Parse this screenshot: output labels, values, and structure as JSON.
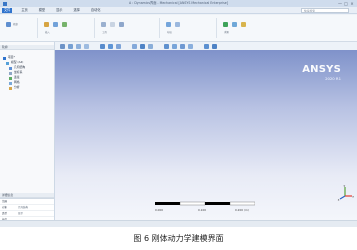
{
  "window": {
    "title": "A : Dynamics界面 - Mechanical [ANSYS Mechanical Enterprise]",
    "controls": [
      "—",
      "□",
      "×"
    ]
  },
  "menu": {
    "items": [
      "文件",
      "主页",
      "模型",
      "显示",
      "选择",
      "自动化"
    ]
  },
  "search": {
    "placeholder": "快速搜索"
  },
  "ribbon": {
    "groups": [
      "轮廓",
      "插入",
      "工具",
      "布局",
      "求解"
    ]
  },
  "left_panel": {
    "outline_title": "轮廓",
    "tree_root": "项目*",
    "tree_items": [
      "模型 (A4)",
      "几何结构",
      "坐标系",
      "连接",
      "网格",
      "分析"
    ],
    "details_title": "详细信息",
    "details_rows": [
      {
        "label": "范围",
        "value": ""
      },
      {
        "label": "对象",
        "value": "几何结构"
      },
      {
        "label": "类型",
        "value": "显示"
      },
      {
        "label": "长度",
        "value": ""
      },
      {
        "label": "单位",
        "value": ""
      },
      {
        "label": "统计",
        "value": ""
      },
      {
        "label": "选择",
        "value": ""
      }
    ]
  },
  "viewport": {
    "brand": "ANSYS",
    "version": "2020 R1",
    "scale": {
      "left": "0.000",
      "middle": "0.100",
      "right": "0.200 (m)"
    },
    "axes": {
      "x": "x",
      "y": "y",
      "z": "z"
    }
  },
  "caption": {
    "text": "图 6    刚体动力学建模界面"
  }
}
